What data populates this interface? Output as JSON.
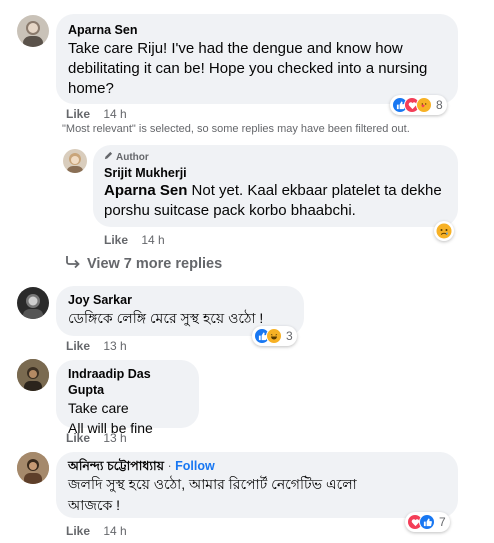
{
  "comments": [
    {
      "author": "Aparna Sen",
      "text": "Take care Riju! I've had the dengue and know how debilitating it can be! Hope you checked into a nursing home?",
      "like_label": "Like",
      "time": "14 h",
      "reaction_count": "8"
    },
    {
      "author": "Joy Sarkar",
      "text": "ডেঙ্গিকে লেঙ্গি মেরে সুস্থ হয়ে ওঠো !",
      "like_label": "Like",
      "time": "13 h",
      "reaction_count": "3"
    },
    {
      "author": "Indraadip Das Gupta",
      "text_line1": "Take care",
      "text_line2": "All will be fine",
      "like_label": "Like",
      "time": "13 h"
    },
    {
      "author": "অনিন্দ্য চট্টোপাধ্যায়",
      "follow_label": "Follow",
      "separator": "·",
      "text_line1": "জলদি সুস্থ হয়ে ওঠো, আমার রিপোর্ট নেগেটিভ এলো",
      "text_line2": "আজকে !",
      "like_label": "Like",
      "time": "14 h",
      "reaction_count": "7"
    }
  ],
  "filter_note": "\"Most relevant\" is selected, so some replies may have been filtered out.",
  "reply": {
    "badge": "Author",
    "author": "Srijit Mukherji",
    "mention": "Aparna Sen",
    "text_line1": " Not yet. Kaal ekbaar platelet ta dekhe",
    "text_line2": "porshu suitcase pack korbo bhaabchi.",
    "like_label": "Like",
    "time": "14 h"
  },
  "view_more_label": "View 7 more replies",
  "colors": {
    "bubble": "#f0f2f5",
    "like_blue": "#1877f2",
    "love_red": "#f33e58",
    "care_yellow": "#f7b125",
    "meta_gray": "#65676b"
  }
}
